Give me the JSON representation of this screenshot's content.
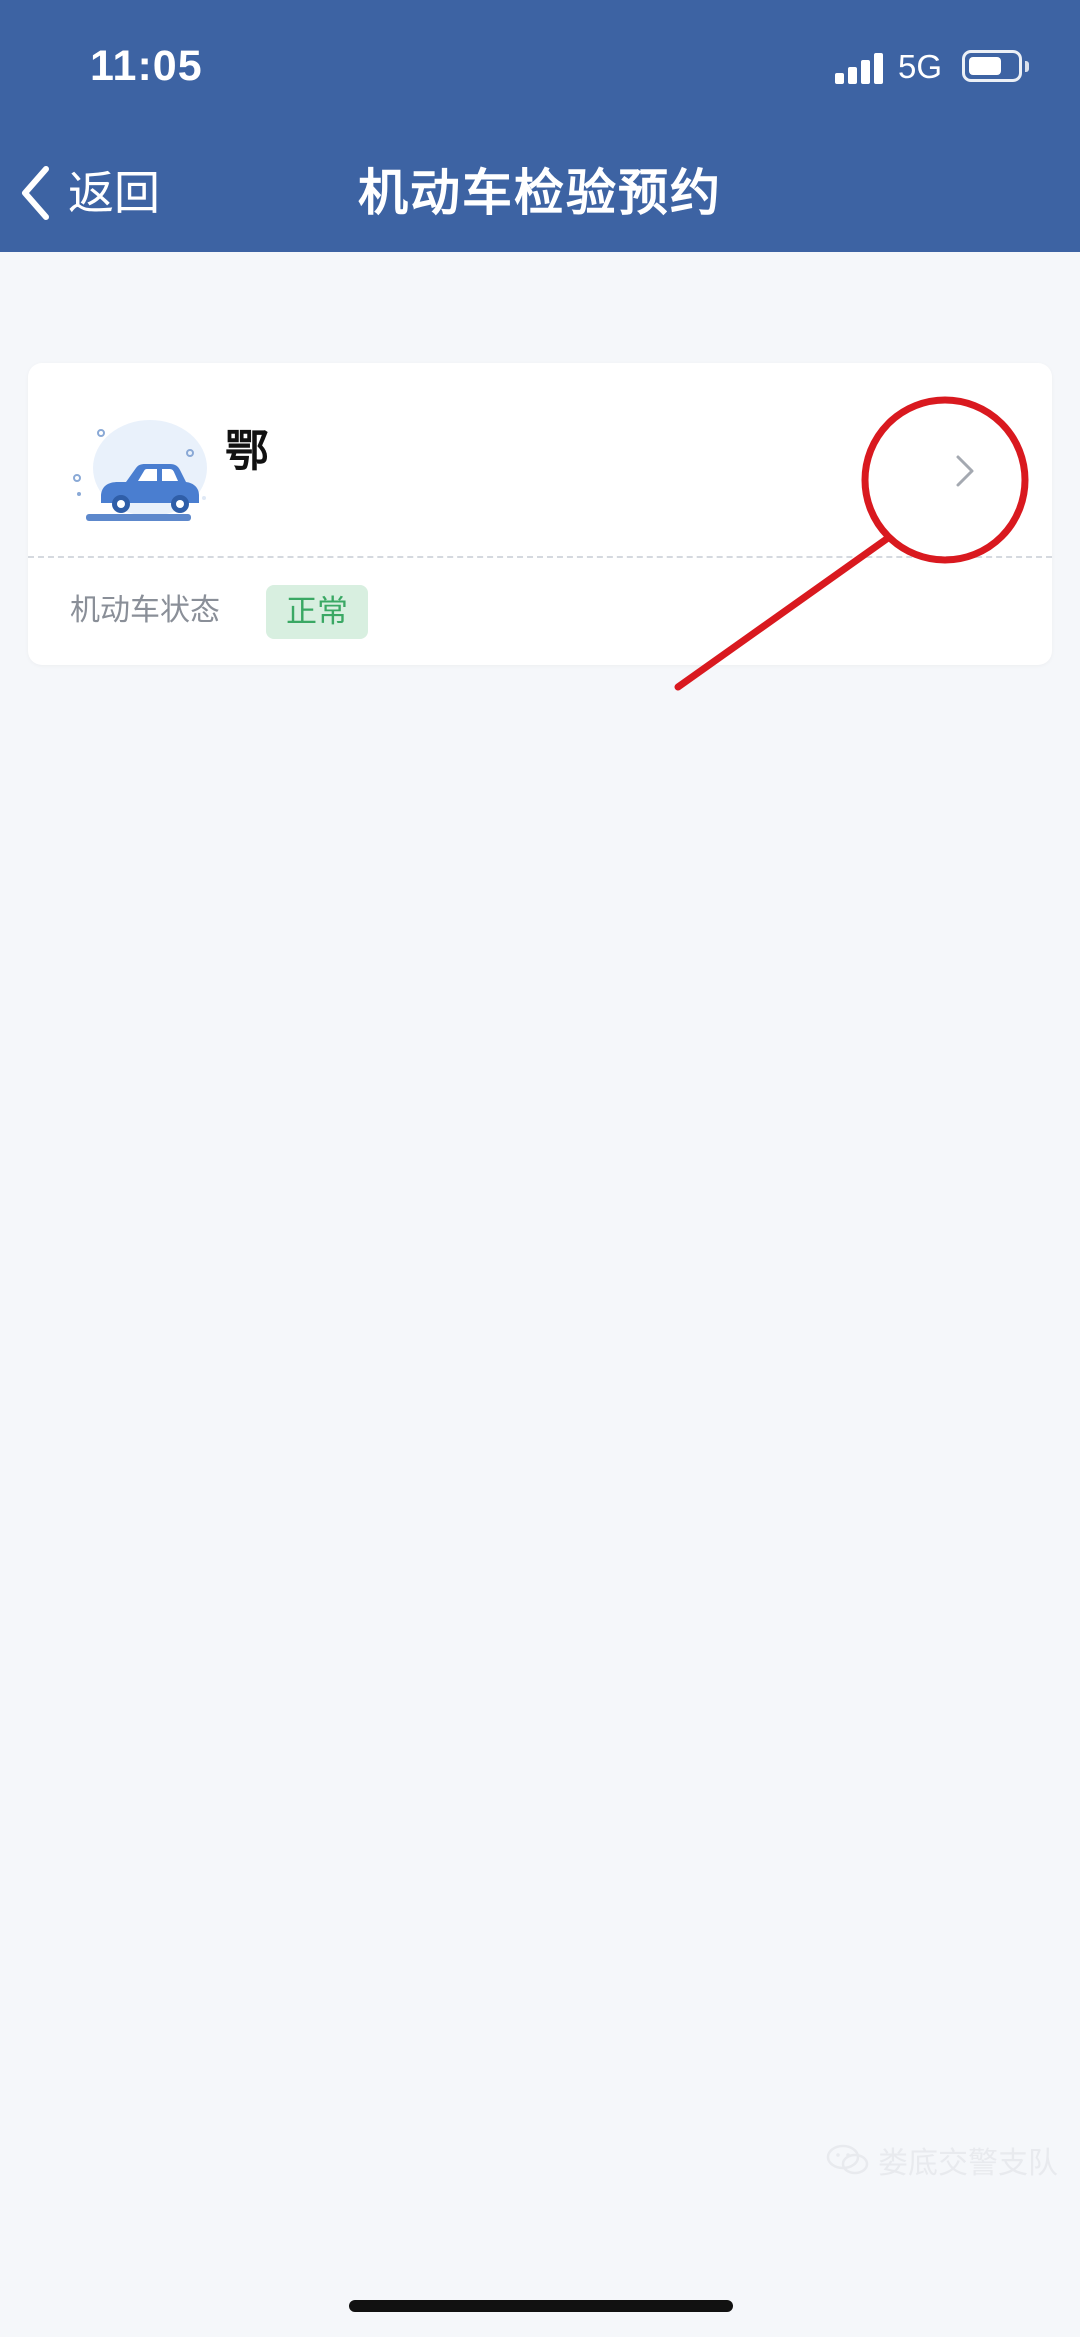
{
  "status_bar": {
    "time": "11:05",
    "network": "5G",
    "signal_icon": "signal-bars-icon",
    "battery_icon": "battery-icon"
  },
  "nav": {
    "back_label": "返回",
    "title": "机动车检验预约",
    "back_icon": "chevron-left-icon"
  },
  "vehicle_card": {
    "plate": "鄂",
    "status_label": "机动车状态",
    "status_value": "正常",
    "illustration_icon": "car-icon",
    "detail_icon": "chevron-right-icon"
  },
  "annotation": {
    "color": "#d9191f"
  },
  "watermark": {
    "text": "娄底交警支队",
    "icon": "wechat-icon"
  },
  "colors": {
    "header": "#3d63a3",
    "background": "#f5f7fa",
    "status_badge_bg": "#d8efe0",
    "status_badge_text": "#3aa864"
  }
}
